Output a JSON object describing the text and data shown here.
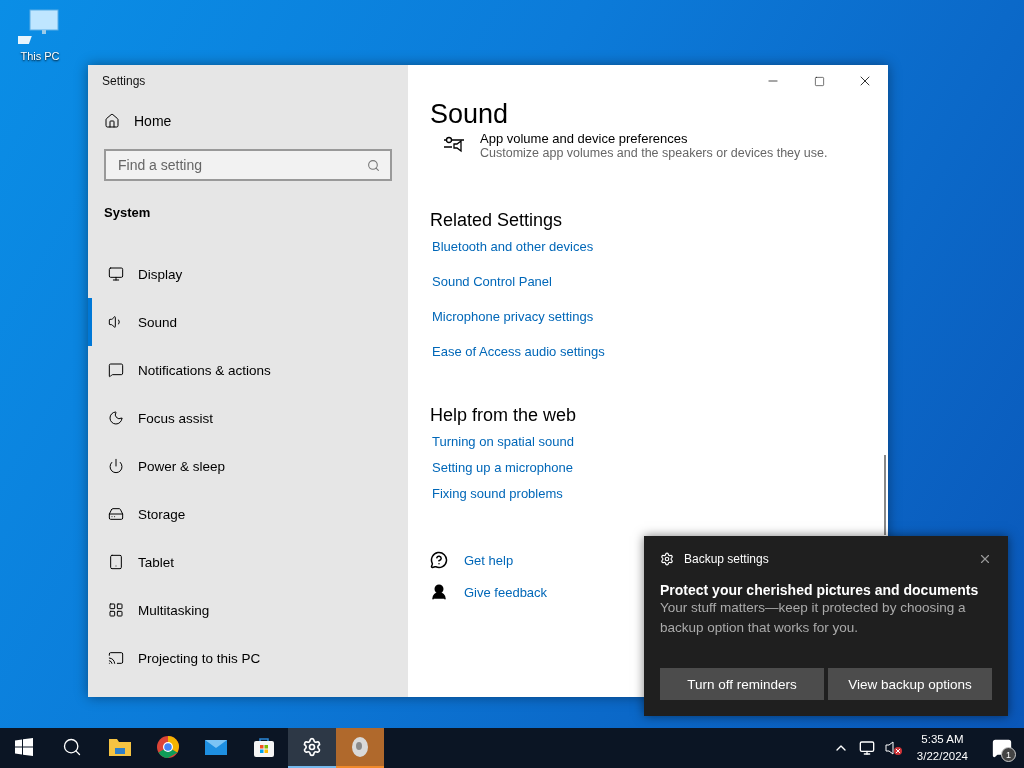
{
  "desktop": {
    "icons": [
      {
        "label": "This PC"
      }
    ]
  },
  "window": {
    "title": "Settings",
    "sidebar": {
      "home": "Home",
      "search": {
        "placeholder": "Find a setting"
      },
      "section": "System",
      "items": [
        {
          "label": "Display",
          "selected": false
        },
        {
          "label": "Sound",
          "selected": true
        },
        {
          "label": "Notifications & actions",
          "selected": false
        },
        {
          "label": "Focus assist",
          "selected": false
        },
        {
          "label": "Power & sleep",
          "selected": false
        },
        {
          "label": "Storage",
          "selected": false
        },
        {
          "label": "Tablet",
          "selected": false
        },
        {
          "label": "Multitasking",
          "selected": false
        },
        {
          "label": "Projecting to this PC",
          "selected": false
        }
      ]
    },
    "page": {
      "title": "Sound",
      "app_volume": {
        "title": "App volume and device preferences",
        "description": "Customize app volumes and the speakers or devices they use."
      },
      "related": {
        "heading": "Related Settings",
        "links": [
          "Bluetooth and other devices",
          "Sound Control Panel",
          "Microphone privacy settings",
          "Ease of Access audio settings"
        ]
      },
      "help": {
        "heading": "Help from the web",
        "links": [
          "Turning on spatial sound",
          "Setting up a microphone",
          "Fixing sound problems"
        ]
      },
      "footer_links": [
        {
          "kind": "help",
          "label": "Get help"
        },
        {
          "kind": "feedback",
          "label": "Give feedback"
        }
      ]
    }
  },
  "toast": {
    "app": "Backup settings",
    "title": "Protect your cherished pictures and documents",
    "body": "Your stuff matters—keep it protected by choosing a backup option that works for you.",
    "buttons": [
      "Turn off reminders",
      "View backup options"
    ]
  },
  "taskbar": {
    "apps": [
      {
        "kind": "explorer",
        "active": false
      },
      {
        "kind": "chrome",
        "active": false
      },
      {
        "kind": "mail",
        "active": false
      },
      {
        "kind": "store",
        "active": false
      },
      {
        "kind": "settings",
        "active": true
      },
      {
        "kind": "app",
        "active": true
      }
    ],
    "time": "5:35 AM",
    "date": "3/22/2024",
    "notifications": "1"
  }
}
